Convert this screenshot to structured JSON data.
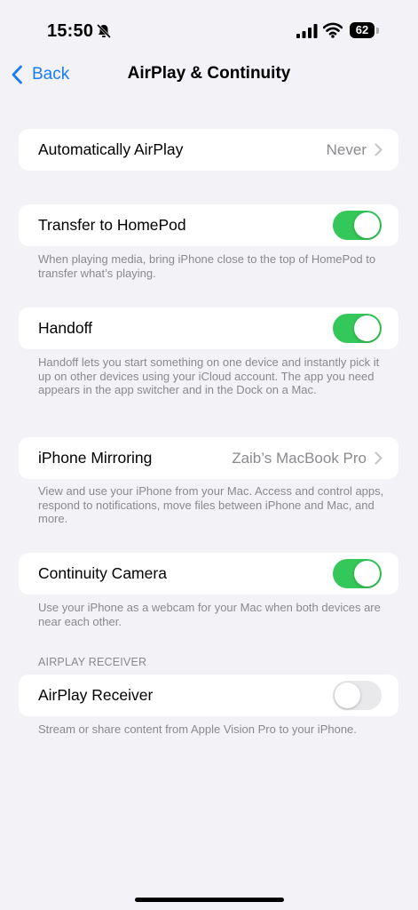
{
  "status_bar": {
    "time": "15:50",
    "battery": "62",
    "icons": [
      "bell-slash-icon",
      "signal-icon",
      "wifi-icon",
      "battery-icon"
    ]
  },
  "nav": {
    "back_label": "Back",
    "title": "AirPlay & Continuity"
  },
  "rows": {
    "auto_airplay": {
      "label": "Automatically AirPlay",
      "value": "Never"
    },
    "homepod": {
      "label": "Transfer to HomePod",
      "enabled": true,
      "footer": "When playing media, bring iPhone close to the top of HomePod to transfer what’s playing."
    },
    "handoff": {
      "label": "Handoff",
      "enabled": true,
      "footer": "Handoff lets you start something on one device and instantly pick it up on other devices using your iCloud account. The app you need appears in the app switcher and in the Dock on a Mac."
    },
    "mirroring": {
      "label": "iPhone Mirroring",
      "value": "Zaib’s MacBook Pro",
      "footer": "View and use your iPhone from your Mac. Access and control apps, respond to notifications, move files between iPhone and Mac, and more."
    },
    "continuity_camera": {
      "label": "Continuity Camera",
      "enabled": true,
      "footer": "Use your iPhone as a webcam for your Mac when both devices are near each other."
    },
    "airplay_receiver": {
      "section_header": "AIRPLAY RECEIVER",
      "label": "AirPlay Receiver",
      "enabled": false,
      "footer": "Stream or share content from Apple Vision Pro to your iPhone."
    }
  },
  "colors": {
    "accent": "#1a7df5",
    "toggle_on": "#34c759",
    "toggle_off": "#e9e9eb",
    "background": "#f2f2f7",
    "secondary_text": "#8a8a8e"
  }
}
